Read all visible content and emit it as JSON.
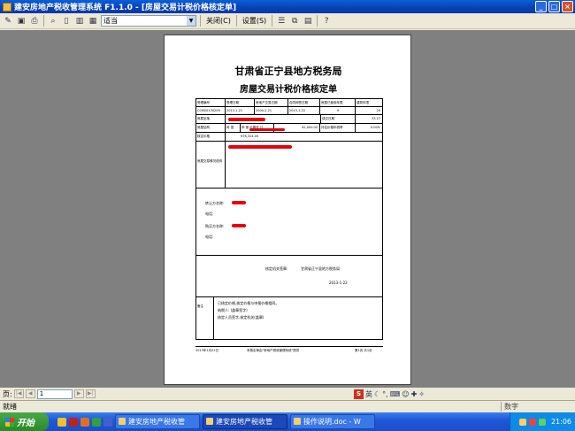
{
  "window": {
    "title": "建安房地产税收管理系统 F1.1.0 - [房屋交易计税价格核定单]",
    "controls": [
      "_",
      "□",
      "×"
    ]
  },
  "toolbar": {
    "zoom_value": "适当",
    "close_label": "关闭(C)",
    "setup_label": "设置(S)"
  },
  "document": {
    "title": "甘肃省正宁县地方税务局",
    "subtitle": "房屋交易计税价格核定单",
    "header_row": [
      "受理编号",
      "受理日期",
      "房地产交易日期",
      "合同网签日期",
      "房屋已使用年限",
      "建筑年限"
    ],
    "data_row": [
      "CCM20130209",
      "2013-1-21",
      "2004-2-21",
      "2013-1-22",
      "9",
      "20"
    ],
    "row2": {
      "c1": "房屋坐落",
      "c3": "成交日期",
      "c4": "33.27"
    },
    "row3": {
      "c1": "房屋结构",
      "c2": "砖 混",
      "c3": "申 报 价格折 计",
      "c4": "¥2,000.00",
      "c5": "评估价格年税率",
      "c6": "0.00%"
    },
    "row4": {
      "c1": "核定价格",
      "c2": "¥76,324.00"
    },
    "row5": {
      "c1": "房屋交易情况说明"
    },
    "parties": [
      "转让方名称:",
      "电话:",
      "购买方名称:",
      "电话:"
    ],
    "sign_off": {
      "label": "核定机关签章:",
      "org": "甘肃省正宁县地方税务局",
      "date": "2013-1-22"
    },
    "notes": {
      "label": "备注",
      "lines": [
        "已核定价格,核定价格与申报价格相同。",
        "纳税人: (盖章签字)",
        "核定人员签字,核定机关(盖章)"
      ]
    },
    "footer": {
      "left": "2013年1月22日",
      "center": "本核定单由\"房地产税收管理系统\"提供",
      "right": "第1页 共1页"
    }
  },
  "pager": {
    "label": "页:",
    "current": "1"
  },
  "status": {
    "text": "就绪",
    "num": "数字"
  },
  "taskbar": {
    "start": "开始",
    "tasks": [
      "建安房地产税收管",
      "建安房地产税收管",
      "操作说明.doc - W"
    ],
    "clock": "21:06"
  },
  "ime": {
    "label": "英"
  }
}
